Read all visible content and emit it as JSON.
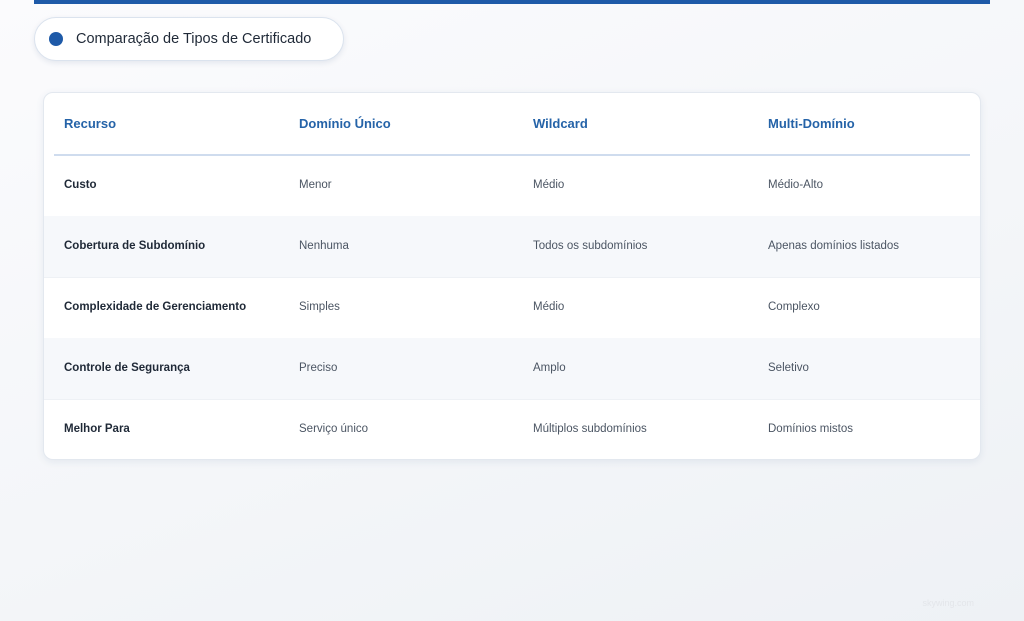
{
  "header": {
    "title": "Comparação de Tipos de Certificado",
    "accent_color": "#1e5aa8"
  },
  "table": {
    "columns": [
      "Recurso",
      "Domínio Único",
      "Wildcard",
      "Multi-Domínio"
    ],
    "rows": [
      [
        "Custo",
        "Menor",
        "Médio",
        "Médio-Alto"
      ],
      [
        "Cobertura de Subdomínio",
        "Nenhuma",
        "Todos os subdomínios",
        "Apenas domínios listados"
      ],
      [
        "Complexidade de Gerenciamento",
        "Simples",
        "Médio",
        "Complexo"
      ],
      [
        "Controle de Segurança",
        "Preciso",
        "Amplo",
        "Seletivo"
      ],
      [
        "Melhor Para",
        "Serviço único",
        "Múltiplos subdomínios",
        "Domínios mistos"
      ]
    ],
    "header_color": "#2563a8"
  },
  "watermark": "skywing.com"
}
